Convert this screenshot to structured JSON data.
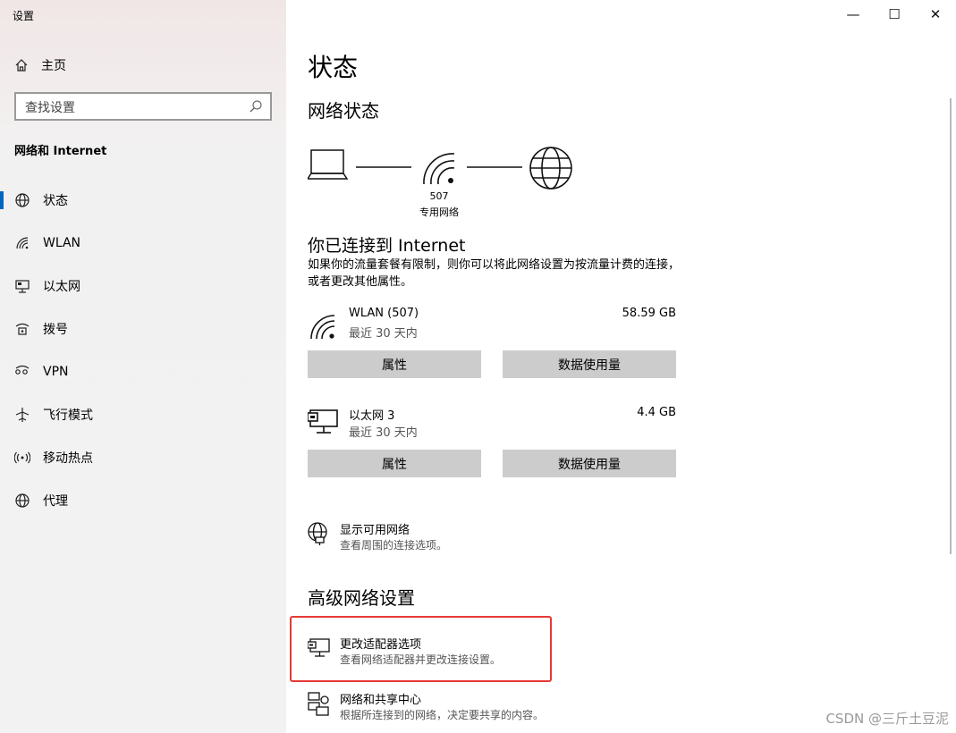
{
  "window": {
    "title": "设置",
    "minimize": "—",
    "maximize": "☐",
    "close": "✕"
  },
  "sidebar": {
    "home_label": "主页",
    "search_placeholder": "查找设置",
    "section_label": "网络和 Internet",
    "items": [
      {
        "label": "状态",
        "icon": "globe-icon",
        "active": true
      },
      {
        "label": "WLAN",
        "icon": "wifi-icon"
      },
      {
        "label": "以太网",
        "icon": "ethernet-icon"
      },
      {
        "label": "拨号",
        "icon": "dialup-icon"
      },
      {
        "label": "VPN",
        "icon": "vpn-icon"
      },
      {
        "label": "飞行模式",
        "icon": "airplane-icon"
      },
      {
        "label": "移动热点",
        "icon": "hotspot-icon"
      },
      {
        "label": "代理",
        "icon": "globe-icon"
      }
    ]
  },
  "main": {
    "title": "状态",
    "network_status_heading": "网络状态",
    "network_name": "507",
    "network_type": "专用网络",
    "connected_title": "你已连接到 Internet",
    "connected_desc": "如果你的流量套餐有限制，则你可以将此网络设置为按流量计费的连接，或者更改其他属性。",
    "adapters": [
      {
        "name": "WLAN (507)",
        "period": "最近 30 天内",
        "usage": "58.59 GB",
        "btn_properties": "属性",
        "btn_data_usage": "数据使用量"
      },
      {
        "name": "以太网 3",
        "period": "最近 30 天内",
        "usage": "4.4 GB",
        "btn_properties": "属性",
        "btn_data_usage": "数据使用量"
      }
    ],
    "show_networks": {
      "title": "显示可用网络",
      "subtitle": "查看周围的连接选项。"
    },
    "advanced_heading": "高级网络设置",
    "change_adapter": {
      "title": "更改适配器选项",
      "subtitle": "查看网络适配器并更改连接设置。"
    },
    "sharing_center": {
      "title": "网络和共享中心",
      "subtitle": "根据所连接到的网络，决定要共享的内容。"
    }
  },
  "watermark": "CSDN @三斤土豆泥",
  "colors": {
    "accent": "#0067c0",
    "highlight": "#e53935",
    "button": "#cccccc"
  }
}
